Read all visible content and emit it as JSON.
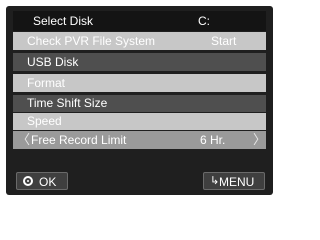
{
  "menu": {
    "title": {
      "label": "Select Disk",
      "value": "C:"
    },
    "items": [
      {
        "label": "Check PVR File System",
        "value": "Start"
      },
      {
        "label": "USB Disk"
      },
      {
        "label": "Format"
      },
      {
        "label": "Time Shift Size"
      },
      {
        "label": "Speed"
      },
      {
        "label": "Free Record Limit",
        "value": "6 Hr.",
        "prev_arrow": "〈",
        "next_arrow": "〉"
      }
    ]
  },
  "footer": {
    "ok_label": "OK",
    "ok_icon": "ok-circle-icon",
    "menu_label": "MENU",
    "menu_icon": "return-arrow-icon"
  },
  "colors": {
    "background": "#1f1f1f",
    "row_light": "#c7c7c7",
    "row_dark": "#4f4f4f",
    "row_selected": "#9a9a9a",
    "text": "#ffffff"
  }
}
